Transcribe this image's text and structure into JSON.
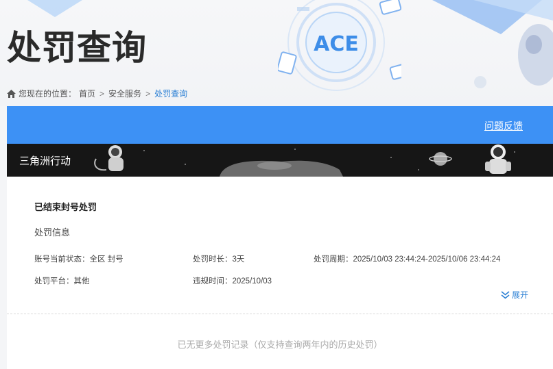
{
  "header": {
    "title": "处罚查询",
    "logo_text": "ACE",
    "breadcrumb": {
      "label": "您现在的位置：",
      "items": [
        "首页",
        "安全服务",
        "处罚查询"
      ],
      "separator": ">"
    }
  },
  "panel": {
    "feedback_link": "问题反馈",
    "game_name": "三角洲行动",
    "record": {
      "title": "已结束封号处罚",
      "section": "处罚信息",
      "fields": {
        "account_status": "账号当前状态：全区 封号",
        "duration": "处罚时长：3天",
        "period": "处罚周期：2025/10/03 23:44:24-2025/10/06 23:44:24",
        "platform": "处罚平台：其他",
        "violation_time": "违规时间：2025/10/03"
      },
      "expand_label": "展开"
    },
    "no_more_text": "已无更多处罚记录（仅支持查询两年内的历史处罚）"
  },
  "colors": {
    "accent_blue": "#3d91f5",
    "link_blue": "#2a7fd4",
    "banner_dark": "#161616"
  },
  "icons": [
    "home-icon",
    "chevron-double-down-icon",
    "ace-logo",
    "astronaut-icon",
    "planet-icon"
  ]
}
